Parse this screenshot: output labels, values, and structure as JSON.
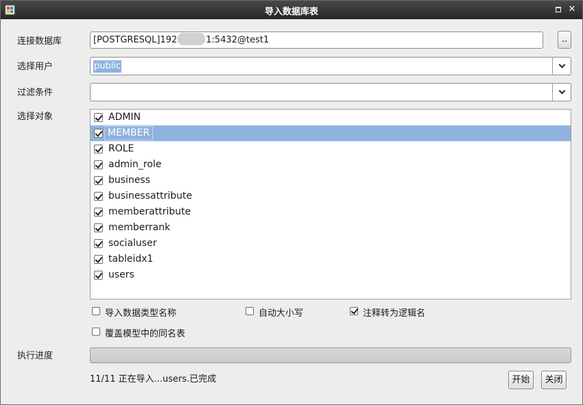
{
  "window": {
    "title": "导入数据库表",
    "icon": "app-icon",
    "controls": {
      "maximize": "maximize-icon",
      "close": "close-icon"
    }
  },
  "connection": {
    "label": "连接数据库",
    "value_prefix": "[POSTGRESQL]192",
    "value_suffix": "1:5432@test1",
    "browse_label": ".."
  },
  "user": {
    "label": "选择用户",
    "value": "public"
  },
  "filter": {
    "label": "过滤条件",
    "value": ""
  },
  "objects": {
    "label": "选择对象",
    "items": [
      {
        "name": "ADMIN",
        "checked": true,
        "selected": false
      },
      {
        "name": "MEMBER",
        "checked": true,
        "selected": true
      },
      {
        "name": "ROLE",
        "checked": true,
        "selected": false
      },
      {
        "name": "admin_role",
        "checked": true,
        "selected": false
      },
      {
        "name": "business",
        "checked": true,
        "selected": false
      },
      {
        "name": "businessattribute",
        "checked": true,
        "selected": false
      },
      {
        "name": "memberattribute",
        "checked": true,
        "selected": false
      },
      {
        "name": "memberrank",
        "checked": true,
        "selected": false
      },
      {
        "name": "socialuser",
        "checked": true,
        "selected": false
      },
      {
        "name": "tableidx1",
        "checked": true,
        "selected": false
      },
      {
        "name": "users",
        "checked": true,
        "selected": false
      }
    ]
  },
  "options": {
    "import_type_names": {
      "label": "导入数据类型名称",
      "checked": false
    },
    "auto_case": {
      "label": "自动大小写",
      "checked": false
    },
    "comment_to_logical": {
      "label": "注释转为逻辑名",
      "checked": true
    },
    "overwrite_same_name": {
      "label": "覆盖模型中的同名表",
      "checked": false
    }
  },
  "progress": {
    "label": "执行进度",
    "value": 0
  },
  "status": {
    "text": "11/11 正在导入...users.已完成"
  },
  "buttons": {
    "start": "开始",
    "close": "关闭"
  },
  "colors": {
    "titlebar": "#2e2e2e",
    "selection": "#8fb3de",
    "window_bg": "#ededed"
  }
}
